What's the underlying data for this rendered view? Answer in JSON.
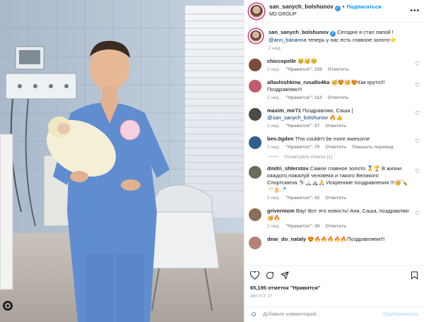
{
  "header": {
    "username": "san_sanych_bolshunov",
    "separator": "•",
    "follow_label": "Подписаться",
    "subtitle": "MD GROUP",
    "more_icon": "more-icon"
  },
  "caption": {
    "username": "san_sanych_bolshunov",
    "text_before": "Сегодня я стал папой !",
    "mention": "@ann_bananna",
    "text_after": "теперь у нас есть главное золото⭐",
    "time": "2 нед."
  },
  "comments": [
    {
      "username": "chiccopelle",
      "text": "🥹🥳🥺",
      "time": "2 нед.",
      "likes": "\"Нравится\": 226",
      "reply": "Ответить",
      "avatar_color": "#7a4a3a"
    },
    {
      "username": "allashishkina_rusallo4ka",
      "text": "🥳😍🥳😍Как круто!!! Поздравляю!!!",
      "time": "2 нед.",
      "likes": "\"Нравится\": 113",
      "reply": "Ответить",
      "avatar_color": "#c25b6b"
    },
    {
      "username": "maxim_mir71",
      "text": "Поздравляю, Саша |",
      "mention": "@san_sanych_bolshunov",
      "text_after": "🔥👍",
      "time": "2 нед.",
      "likes": "\"Нравится\": 27",
      "reply": "Ответить",
      "avatar_color": "#4a4a4a"
    },
    {
      "username": "ben.0gden",
      "text": "This couldn't be more awesome",
      "time": "2 нед.",
      "likes": "\"Нравится\": 70",
      "reply": "Ответить",
      "translate": "Показать перевод",
      "replies": "Посмотреть ответы (1)",
      "avatar_color": "#2f5f8a"
    },
    {
      "username": "dmitri_shterstov",
      "text": "Самое главное золото 🥇🏆 В жизни каждого,пожалуй человека и такого Великого Спортсмена ⛷️🏔️⛰️🙏 Искренние поздравления !!!🥳🍾🥂🎂🍼",
      "time": "2 нед.",
      "likes": "\"Нравится\": 42",
      "reply": "Ответить",
      "avatar_color": "#6b6b5a"
    },
    {
      "username": "grivermom",
      "text": "Вау! Вот это новость! Аня, Саша, поздравляю 🥳🔥",
      "time": "2 нед.",
      "likes": "\"Нравится\": 30",
      "reply": "Ответить",
      "avatar_color": "#8a6d5a"
    },
    {
      "username": "dear_do_nataly",
      "text": "😍🔥🔥🔥🔥🔥Поздравляем!!!",
      "time": "2 нед.",
      "likes": "",
      "reply": "",
      "avatar_color": "#b4847a"
    }
  ],
  "footer": {
    "likes_count": "65,195 отметок \"Нравится\"",
    "date": "АВГУСТ 27",
    "comment_placeholder": "Добавьте комментарий...",
    "post_label": "Опубликовать",
    "icons": [
      "heart-icon",
      "comment-icon",
      "share-icon",
      "save-icon",
      "emoji-icon"
    ]
  },
  "colors": {
    "accent": "#0095f6",
    "verified": "#3897f0",
    "muted": "#8e8e8e"
  }
}
